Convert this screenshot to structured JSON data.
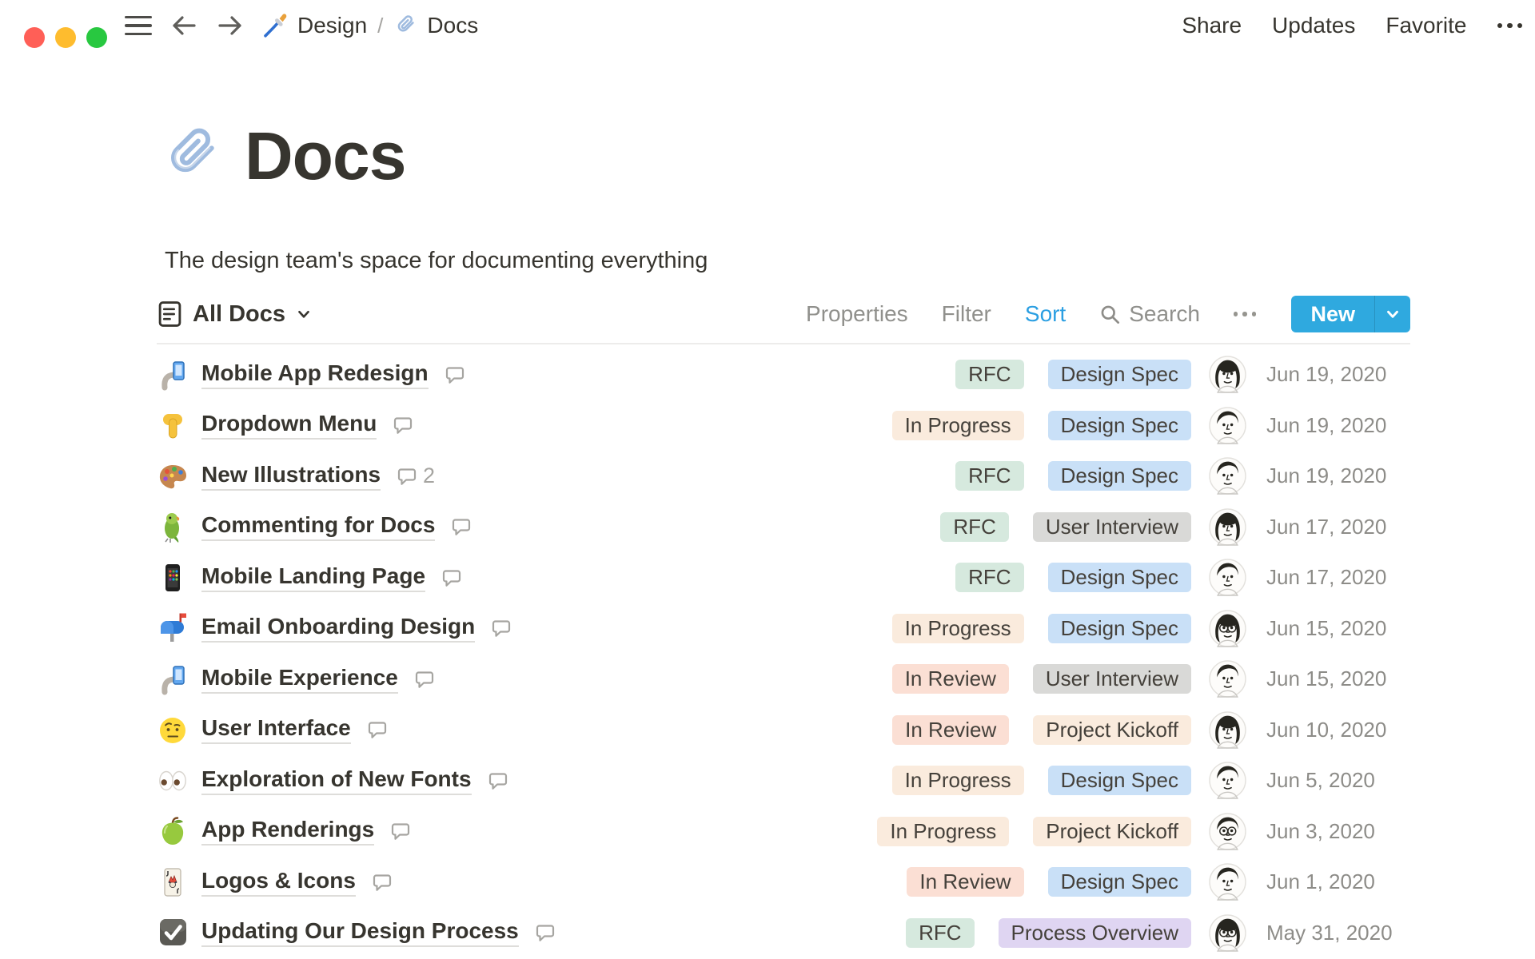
{
  "window": {
    "breadcrumb": [
      {
        "icon": "paintbrush-emoji",
        "label": "Design"
      },
      {
        "icon": "paperclip-emoji",
        "label": "Docs"
      }
    ],
    "separator": "/",
    "actions": {
      "share": "Share",
      "updates": "Updates",
      "favorite": "Favorite"
    }
  },
  "page": {
    "icon": "paperclip-emoji",
    "title": "Docs",
    "subtitle": "The design team's space for documenting everything"
  },
  "toolbar": {
    "view_label": "All Docs",
    "properties": "Properties",
    "filter": "Filter",
    "sort": "Sort",
    "search": "Search",
    "new_label": "New"
  },
  "colors": {
    "traffic_red": "#FF5F57",
    "traffic_yellow": "#FEBC2E",
    "traffic_green": "#28C840",
    "accent_blue": "#2FA9DF",
    "link_blue": "#2B9FE2",
    "badge_green": "#D6E9DE",
    "badge_orange": "#FAEBDD",
    "badge_red": "#FBDFD4",
    "badge_blue": "#C9E0F7",
    "badge_gray": "#D9D9D7",
    "badge_purple": "#DFD5F2"
  },
  "table": {
    "rows": [
      {
        "icon": "selfie-emoji",
        "title": "Mobile App Redesign",
        "comments": null,
        "status": "RFC",
        "status_color": "badge_green",
        "type": "Design Spec",
        "type_color": "badge_blue",
        "avatar": "woman",
        "date": "Jun 19, 2020"
      },
      {
        "icon": "pointing-down-emoji",
        "title": "Dropdown Menu",
        "comments": null,
        "status": "In Progress",
        "status_color": "badge_orange",
        "type": "Design Spec",
        "type_color": "badge_blue",
        "avatar": "man",
        "date": "Jun 19, 2020"
      },
      {
        "icon": "palette-emoji",
        "title": "New Illustrations",
        "comments": 2,
        "status": "RFC",
        "status_color": "badge_green",
        "type": "Design Spec",
        "type_color": "badge_blue",
        "avatar": "man",
        "date": "Jun 19, 2020"
      },
      {
        "icon": "parrot-emoji",
        "title": "Commenting for Docs",
        "comments": null,
        "status": "RFC",
        "status_color": "badge_green",
        "type": "User Interview",
        "type_color": "badge_gray",
        "avatar": "woman",
        "date": "Jun 17, 2020"
      },
      {
        "icon": "mobile-phone-emoji",
        "title": "Mobile Landing Page",
        "comments": null,
        "status": "RFC",
        "status_color": "badge_green",
        "type": "Design Spec",
        "type_color": "badge_blue",
        "avatar": "man",
        "date": "Jun 17, 2020"
      },
      {
        "icon": "mailbox-emoji",
        "title": "Email Onboarding Design",
        "comments": null,
        "status": "In Progress",
        "status_color": "badge_orange",
        "type": "Design Spec",
        "type_color": "badge_blue",
        "avatar": "woman-glasses",
        "date": "Jun 15, 2020"
      },
      {
        "icon": "selfie-emoji",
        "title": "Mobile Experience",
        "comments": null,
        "status": "In Review",
        "status_color": "badge_red",
        "type": "User Interview",
        "type_color": "badge_gray",
        "avatar": "man",
        "date": "Jun 15, 2020"
      },
      {
        "icon": "raised-eyebrow-emoji",
        "title": "User Interface",
        "comments": null,
        "status": "In Review",
        "status_color": "badge_red",
        "type": "Project Kickoff",
        "type_color": "badge_orange",
        "avatar": "woman",
        "date": "Jun 10, 2020"
      },
      {
        "icon": "eyes-emoji",
        "title": "Exploration of New Fonts",
        "comments": null,
        "status": "In Progress",
        "status_color": "badge_orange",
        "type": "Design Spec",
        "type_color": "badge_blue",
        "avatar": "man",
        "date": "Jun 5, 2020"
      },
      {
        "icon": "green-apple-emoji",
        "title": "App Renderings",
        "comments": null,
        "status": "In Progress",
        "status_color": "badge_orange",
        "type": "Project Kickoff",
        "type_color": "badge_orange",
        "avatar": "man-glasses",
        "date": "Jun 3, 2020"
      },
      {
        "icon": "joker-card-emoji",
        "title": "Logos & Icons",
        "comments": null,
        "status": "In Review",
        "status_color": "badge_red",
        "type": "Design Spec",
        "type_color": "badge_blue",
        "avatar": "man",
        "date": "Jun 1, 2020"
      },
      {
        "icon": "checkbox-emoji",
        "title": "Updating Our Design Process",
        "comments": null,
        "status": "RFC",
        "status_color": "badge_green",
        "type": "Process Overview",
        "type_color": "badge_purple",
        "avatar": "woman-glasses",
        "date": "May 31, 2020"
      }
    ]
  }
}
